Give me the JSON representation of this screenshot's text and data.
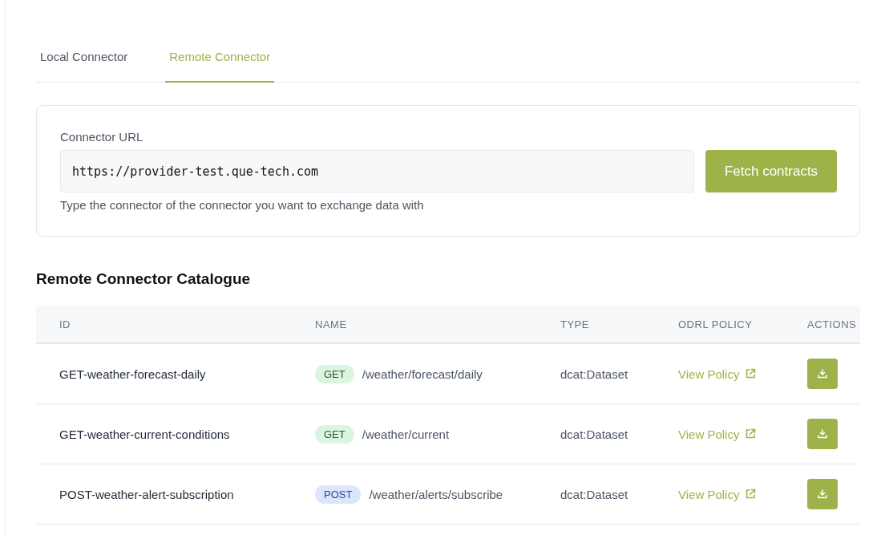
{
  "tabs": [
    {
      "label": "Local Connector",
      "selected": false
    },
    {
      "label": "Remote Connector",
      "selected": true
    }
  ],
  "connector_form": {
    "label": "Connector URL",
    "value": "https://provider-test.que-tech.com",
    "button": "Fetch contracts",
    "hint": "Type the connector of the connector you want to exchange data with"
  },
  "catalogue": {
    "title": "Remote Connector Catalogue",
    "columns": [
      "ID",
      "NAME",
      "TYPE",
      "ODRL POLICY",
      "ACTIONS"
    ],
    "rows": [
      {
        "id": "GET-weather-forecast-daily",
        "method": {
          "label": "GET",
          "kind": "get"
        },
        "path": "/weather/forecast/daily",
        "type": "dcat:Dataset",
        "policy": "View Policy"
      },
      {
        "id": "GET-weather-current-conditions",
        "method": {
          "label": "GET",
          "kind": "get"
        },
        "path": "/weather/current",
        "type": "dcat:Dataset",
        "policy": "View Policy"
      },
      {
        "id": "POST-weather-alert-subscription",
        "method": {
          "label": "POST",
          "kind": "post"
        },
        "path": "/weather/alerts/subscribe",
        "type": "dcat:Dataset",
        "policy": "View Policy"
      }
    ]
  }
}
